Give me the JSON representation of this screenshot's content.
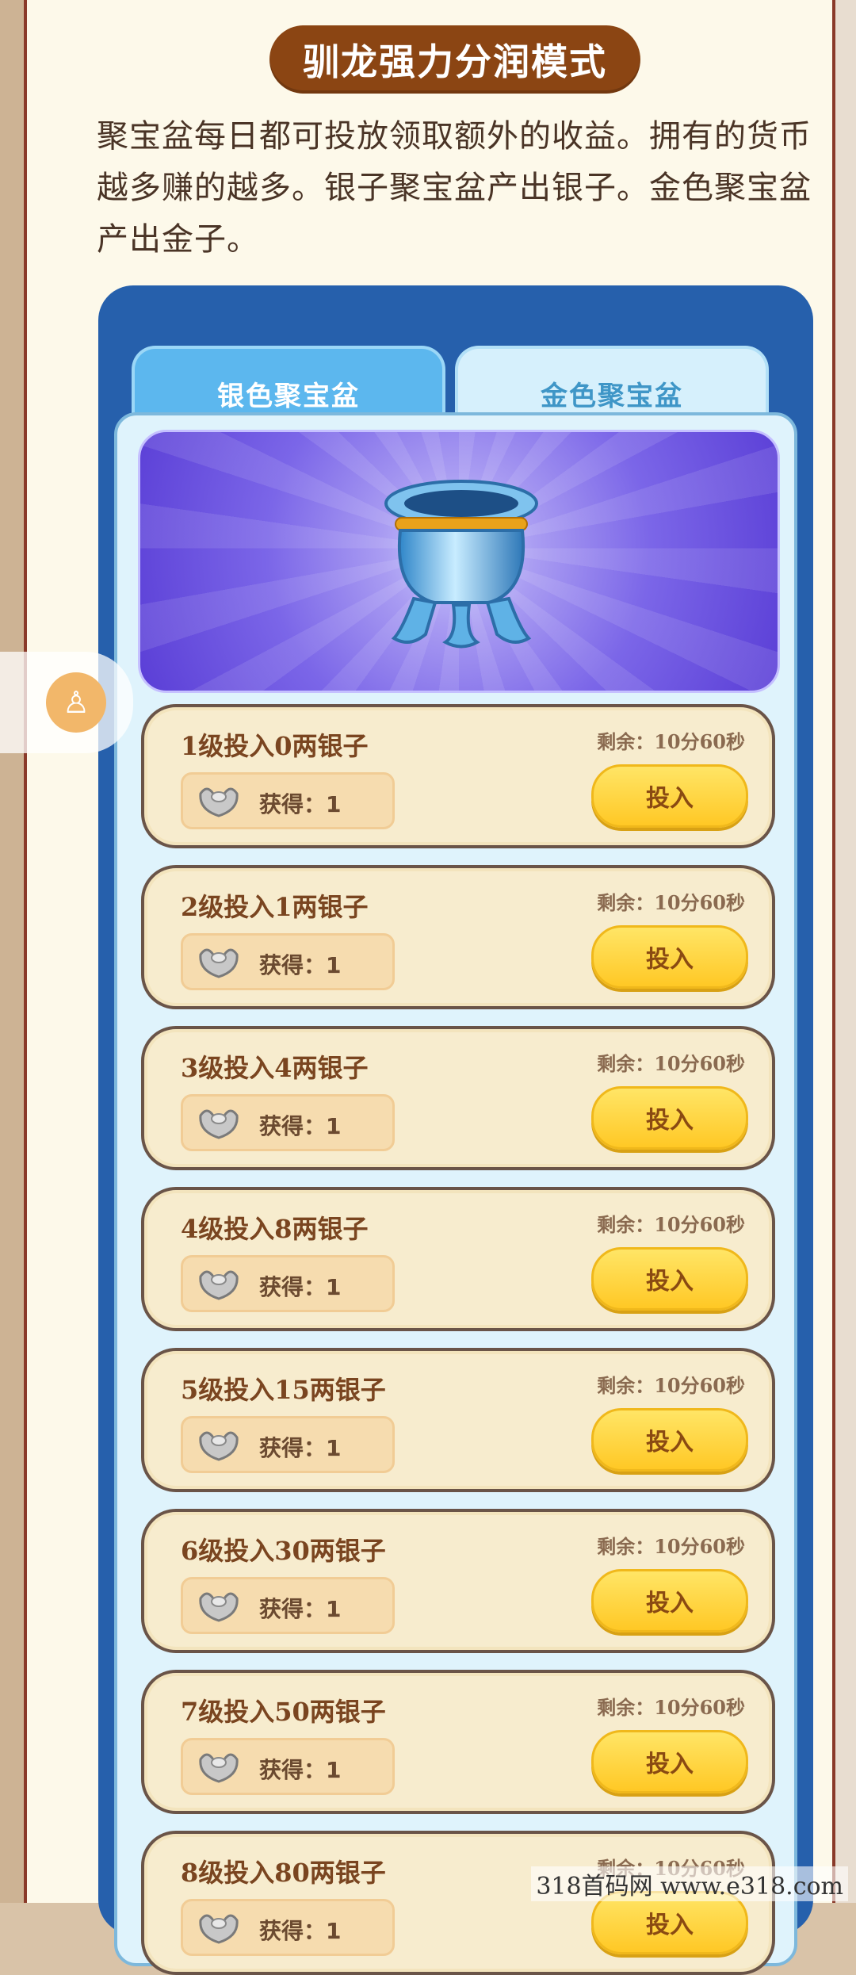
{
  "header": {
    "title": "驯龙强力分润模式"
  },
  "description": "聚宝盆每日都可投放领取额外的收益。拥有的货币越多赚的越多。银子聚宝盆产出银子。金色聚宝盆产出金子。",
  "tabs": [
    {
      "label": "银色聚宝盆",
      "active": true
    },
    {
      "label": "金色聚宝盆",
      "active": false
    }
  ],
  "banner": {
    "icon": "silver-cauldron-icon"
  },
  "levels": [
    {
      "level": "1级投入0两银子",
      "remain": "剩余：10分60秒",
      "gain": "获得：1",
      "button": "投入"
    },
    {
      "level": "2级投入1两银子",
      "remain": "剩余：10分60秒",
      "gain": "获得：1",
      "button": "投入"
    },
    {
      "level": "3级投入4两银子",
      "remain": "剩余：10分60秒",
      "gain": "获得：1",
      "button": "投入"
    },
    {
      "level": "4级投入8两银子",
      "remain": "剩余：10分60秒",
      "gain": "获得：1",
      "button": "投入"
    },
    {
      "level": "5级投入15两银子",
      "remain": "剩余：10分60秒",
      "gain": "获得：1",
      "button": "投入"
    },
    {
      "level": "6级投入30两银子",
      "remain": "剩余：10分60秒",
      "gain": "获得：1",
      "button": "投入"
    },
    {
      "level": "7级投入50两银子",
      "remain": "剩余：10分60秒",
      "gain": "获得：1",
      "button": "投入"
    },
    {
      "level": "8级投入80两银子",
      "remain": "剩余：10分60秒",
      "gain": "获得：1",
      "button": "投入"
    }
  ],
  "floating": {
    "icon": "accessibility-icon",
    "glyph": "♙"
  },
  "watermark": "318首码网  www.e318.com",
  "colors": {
    "title_bg": "#8b4513",
    "panel": "#2660ac",
    "button": "#ffd43b"
  }
}
